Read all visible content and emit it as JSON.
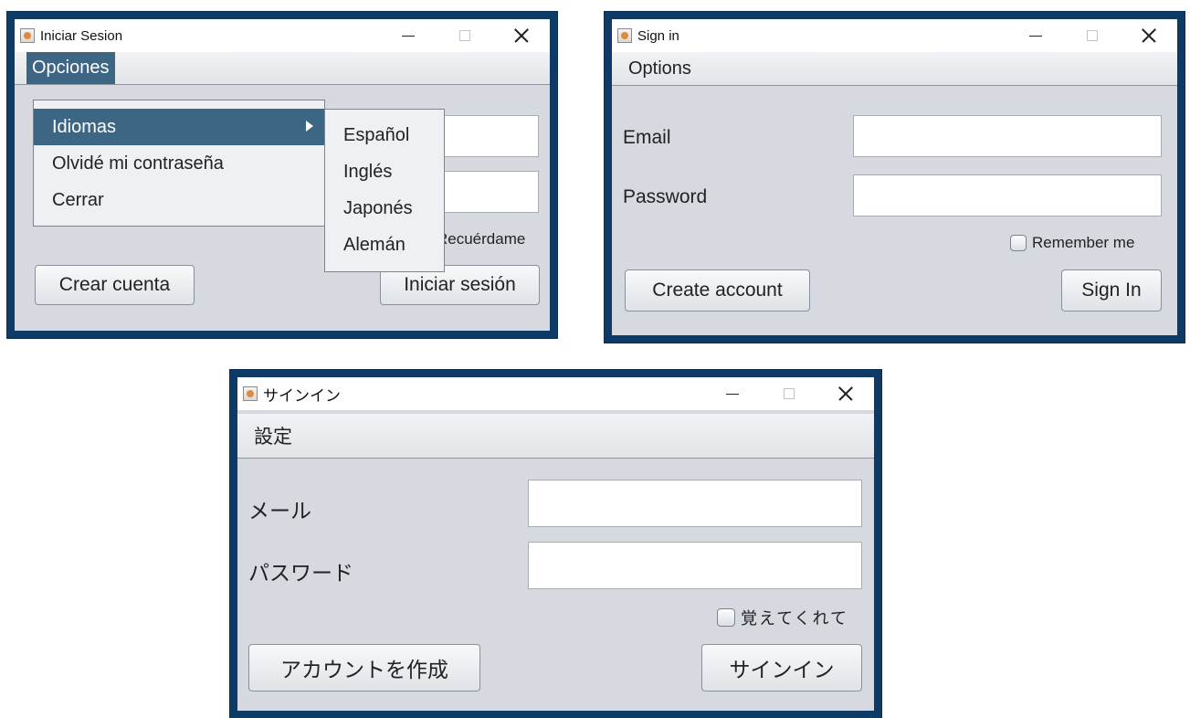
{
  "spanish": {
    "title": "Iniciar Sesion",
    "menu_label": "Opciones",
    "dropdown": [
      "Idiomas",
      "Olvidé mi contraseña",
      "Cerrar"
    ],
    "submenu": [
      "Español",
      "Inglés",
      "Japonés",
      "Alemán"
    ],
    "remember": "Recuérdame",
    "create": "Crear cuenta",
    "signin": "Iniciar sesión"
  },
  "english": {
    "title": "Sign in",
    "menu_label": "Options",
    "email_label": "Email",
    "password_label": "Password",
    "remember": "Remember me",
    "create": "Create account",
    "signin": "Sign In"
  },
  "japanese": {
    "title": "サインイン",
    "menu_label": "設定",
    "email_label": "メール",
    "password_label": "パスワード",
    "remember": "覚えてくれて",
    "create": "アカウントを作成",
    "signin": "サインイン"
  },
  "colors": {
    "border": "#0d3a66",
    "window_bg": "#d6d9df",
    "menu_highlight": "#3d6685"
  },
  "icons": {
    "app": "java-app-icon",
    "minimize": "minimize-icon",
    "maximize": "maximize-icon",
    "close": "close-icon",
    "submenu": "submenu-arrow-icon"
  }
}
